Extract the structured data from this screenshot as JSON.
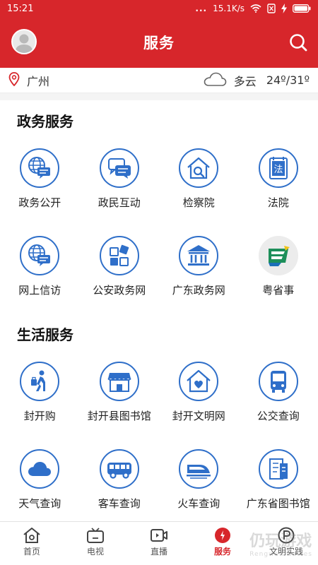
{
  "status_bar": {
    "time": "15:21",
    "dots": "...",
    "speed": "15.1K/s"
  },
  "header": {
    "title": "服务"
  },
  "location": {
    "city": "广州",
    "weather": "多云",
    "temperature": "24º/31º"
  },
  "sections": [
    {
      "title": "政务服务",
      "items": [
        {
          "label": "政务公开",
          "icon": "globe-chat-icon"
        },
        {
          "label": "政民互动",
          "icon": "chat-bubbles-icon"
        },
        {
          "label": "检察院",
          "icon": "house-search-icon"
        },
        {
          "label": "法院",
          "icon": "law-book-icon"
        },
        {
          "label": "网上信访",
          "icon": "globe-chat-icon"
        },
        {
          "label": "公安政务网",
          "icon": "grid-blocks-icon"
        },
        {
          "label": "广东政务网",
          "icon": "government-building-icon"
        },
        {
          "label": "粤省事",
          "icon": "yueshengshi-logo-icon"
        }
      ]
    },
    {
      "title": "生活服务",
      "items": [
        {
          "label": "封开购",
          "icon": "walking-shopper-icon"
        },
        {
          "label": "封开县图书馆",
          "icon": "storefront-icon"
        },
        {
          "label": "封开文明网",
          "icon": "heart-house-icon"
        },
        {
          "label": "公交查询",
          "icon": "bus-front-icon"
        },
        {
          "label": "天气查询",
          "icon": "cloud-icon"
        },
        {
          "label": "客车查询",
          "icon": "coach-icon"
        },
        {
          "label": "火车查询",
          "icon": "bullet-train-icon"
        },
        {
          "label": "广东省图书馆",
          "icon": "library-building-icon"
        }
      ]
    }
  ],
  "tabs": [
    {
      "label": "首页",
      "icon": "home-icon"
    },
    {
      "label": "电视",
      "icon": "tv-icon"
    },
    {
      "label": "直播",
      "icon": "live-video-icon"
    },
    {
      "label": "服务",
      "icon": "service-icon",
      "active": true
    },
    {
      "label": "文明实践",
      "icon": "p-circle-icon"
    }
  ],
  "watermark": {
    "main": "仍玩游戏",
    "sub": "Rengwan Games"
  },
  "colors": {
    "brand_red": "#d7262b",
    "icon_blue": "#2f6fc9"
  }
}
